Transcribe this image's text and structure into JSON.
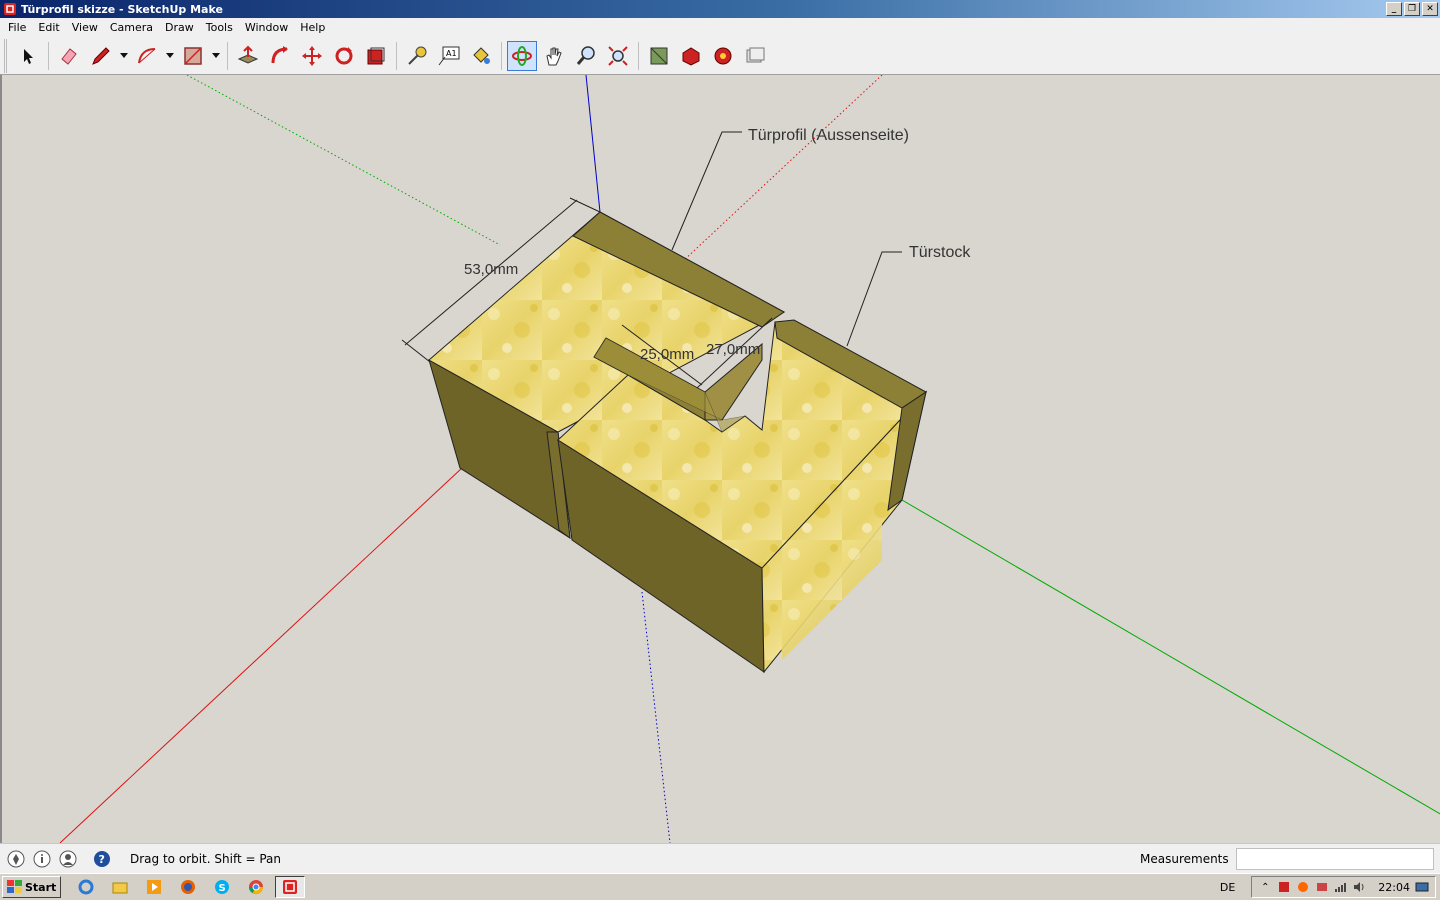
{
  "window": {
    "title": "Türprofil skizze - SketchUp Make",
    "controls": [
      "_",
      "❐",
      "✕"
    ]
  },
  "menu": [
    "File",
    "Edit",
    "View",
    "Camera",
    "Draw",
    "Tools",
    "Window",
    "Help"
  ],
  "toolbar": {
    "tools": [
      {
        "name": "select-tool",
        "icon": "arrow-icon"
      },
      {
        "name": "eraser-tool",
        "icon": "eraser-icon"
      },
      {
        "name": "line-tool",
        "icon": "pencil-icon",
        "dropdown": true
      },
      {
        "name": "arc-tool",
        "icon": "arc-icon",
        "dropdown": true
      },
      {
        "name": "rectangle-tool",
        "icon": "rectangle-icon",
        "dropdown": true
      },
      {
        "name": "push-pull-tool",
        "icon": "push-pull-icon"
      },
      {
        "name": "follow-me-tool",
        "icon": "follow-me-icon"
      },
      {
        "name": "move-tool",
        "icon": "move-icon"
      },
      {
        "name": "rotate-tool",
        "icon": "rotate-icon"
      },
      {
        "name": "scale-tool",
        "icon": "scale-icon"
      },
      {
        "name": "tape-measure-tool",
        "icon": "tape-measure-icon"
      },
      {
        "name": "text-tool",
        "icon": "text-icon",
        "label": "A1"
      },
      {
        "name": "paint-bucket-tool",
        "icon": "paint-bucket-icon"
      },
      {
        "name": "orbit-tool",
        "icon": "orbit-icon",
        "active": true
      },
      {
        "name": "pan-tool",
        "icon": "hand-icon"
      },
      {
        "name": "zoom-tool",
        "icon": "magnifier-icon"
      },
      {
        "name": "zoom-extents-tool",
        "icon": "zoom-extents-icon"
      },
      {
        "name": "3d-warehouse-button",
        "icon": "warehouse-icon"
      },
      {
        "name": "share-model-button",
        "icon": "share-model-icon"
      },
      {
        "name": "extension-warehouse-button",
        "icon": "extension-icon"
      },
      {
        "name": "layout-button",
        "icon": "layout-icon"
      }
    ]
  },
  "model": {
    "labels": {
      "outer_profile": "Türprofil (Aussenseite)",
      "door_frame": "Türstock"
    },
    "dimensions": {
      "width": "53,0mm",
      "groove": "25,0mm",
      "depth": "27,0mm"
    },
    "colors": {
      "face_top": "#e8d36a",
      "face_side": "#6f6428",
      "face_side_light": "#8c7f36",
      "axis_red": "#d11",
      "axis_green": "#0a0",
      "axis_blue": "#00c"
    }
  },
  "status": {
    "hint": "Drag to orbit.  Shift = Pan",
    "measurements_label": "Measurements",
    "measurements_value": ""
  },
  "taskbar": {
    "start_label": "Start",
    "apps": [
      "ie-icon",
      "explorer-icon",
      "media-player-icon",
      "firefox-icon",
      "skype-icon",
      "chrome-icon",
      "sketchup-icon"
    ],
    "language": "DE",
    "clock": "22:04"
  }
}
